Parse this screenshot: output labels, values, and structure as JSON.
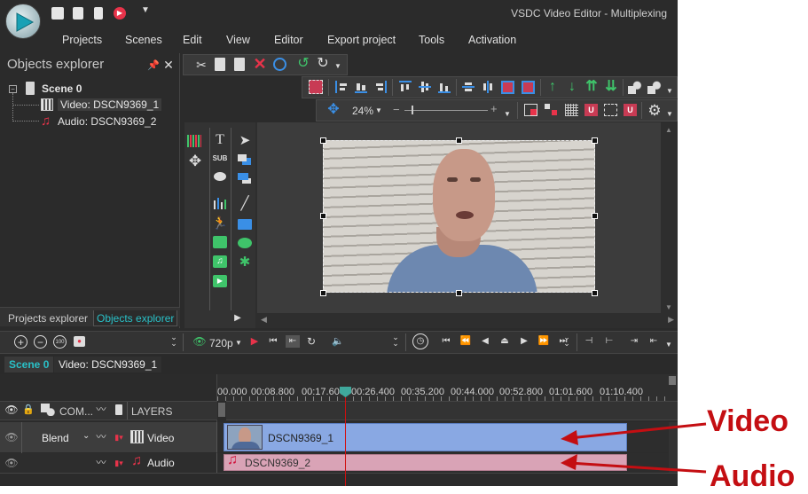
{
  "window": {
    "title": "VSDC Video Editor - Multiplexing"
  },
  "menu": [
    "Projects",
    "Scenes",
    "Edit",
    "View",
    "Editor",
    "Export project",
    "Tools",
    "Activation"
  ],
  "objects_explorer": {
    "title": "Objects explorer",
    "scene": "Scene 0",
    "items": [
      "Video: DSCN9369_1",
      "Audio: DSCN9369_2"
    ]
  },
  "panel_tabs": [
    "Projects explorer",
    "Objects explorer"
  ],
  "zoom": "24%",
  "playback": {
    "resolution": "720p"
  },
  "timeline": {
    "tabs": [
      "Scene 0",
      "Video: DSCN9369_1"
    ],
    "ruler_ticks": [
      "00.000",
      "00:08.800",
      "00:17.600",
      "00:26.400",
      "00:35.200",
      "00:44.000",
      "00:52.800",
      "01:01.600",
      "01:10.400"
    ],
    "header": {
      "composition": "COM...",
      "layers": "LAYERS"
    },
    "rows": [
      {
        "blend": "Blend",
        "name": "Video",
        "clip": "DSCN9369_1"
      },
      {
        "name": "Audio",
        "clip": "DSCN9369_2"
      }
    ]
  },
  "annotations": {
    "video": "Video",
    "audio": "Audio"
  },
  "colors": {
    "accent": "#29c0c7",
    "record": "#e8334a",
    "green": "#3fc46a",
    "blue": "#3a8fe6",
    "video_clip": "#89a8e3",
    "audio_clip": "#d9a3b6",
    "annotation": "#c40e12"
  }
}
